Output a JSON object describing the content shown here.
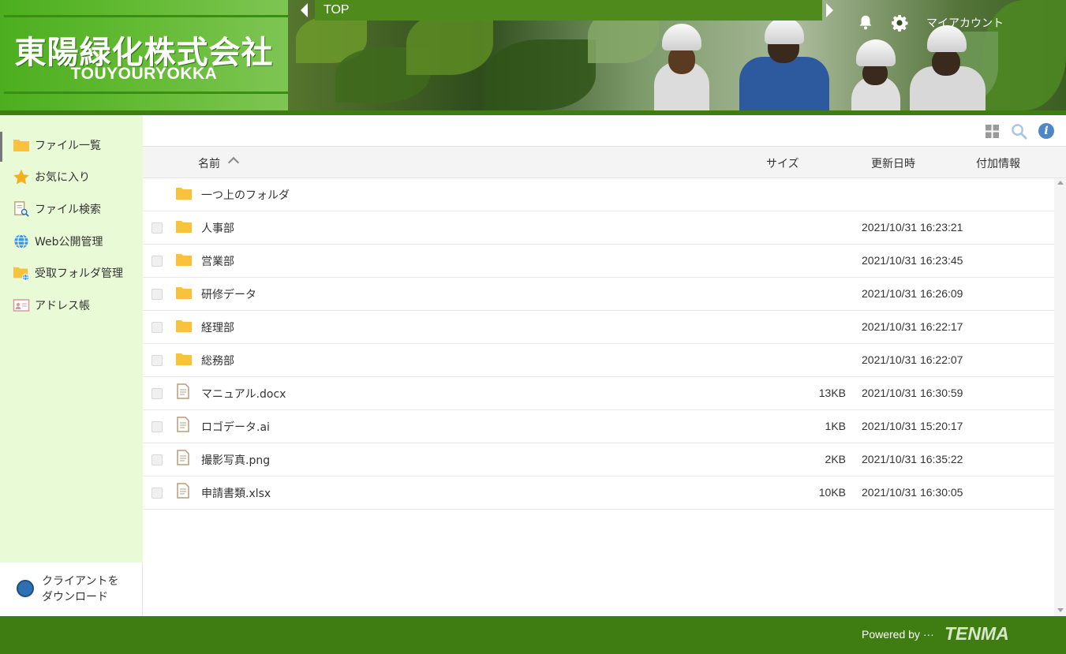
{
  "header": {
    "company_name": "東陽緑化株式会社",
    "company_name_en": "TOUYOURYOKKA",
    "breadcrumb": "TOP",
    "account_label": "マイアカウント"
  },
  "sidebar": {
    "items": [
      {
        "label": "ファイル一覧",
        "icon": "folder-icon"
      },
      {
        "label": "お気に入り",
        "icon": "star-icon"
      },
      {
        "label": "ファイル検索",
        "icon": "file-search-icon"
      },
      {
        "label": "Web公開管理",
        "icon": "globe-icon"
      },
      {
        "label": "受取フォルダ管理",
        "icon": "shared-folder-icon"
      },
      {
        "label": "アドレス帳",
        "icon": "address-book-icon"
      }
    ],
    "download_line1": "クライアントを",
    "download_line2": "ダウンロード"
  },
  "table": {
    "columns": {
      "name": "名前",
      "size": "サイズ",
      "updated": "更新日時",
      "info": "付加情報"
    },
    "parent_folder": "一つ上のフォルダ",
    "rows": [
      {
        "type": "folder",
        "name": "人事部",
        "size": "",
        "updated": "2021/10/31 16:23:21"
      },
      {
        "type": "folder",
        "name": "営業部",
        "size": "",
        "updated": "2021/10/31 16:23:45"
      },
      {
        "type": "folder",
        "name": "研修データ",
        "size": "",
        "updated": "2021/10/31 16:26:09"
      },
      {
        "type": "folder",
        "name": "経理部",
        "size": "",
        "updated": "2021/10/31 16:22:17"
      },
      {
        "type": "folder",
        "name": "総務部",
        "size": "",
        "updated": "2021/10/31 16:22:07"
      },
      {
        "type": "file",
        "name": "マニュアル.docx",
        "size": "13KB",
        "updated": "2021/10/31 16:30:59"
      },
      {
        "type": "file",
        "name": "ロゴデータ.ai",
        "size": "1KB",
        "updated": "2021/10/31 15:20:17"
      },
      {
        "type": "file",
        "name": "撮影写真.png",
        "size": "2KB",
        "updated": "2021/10/31 16:35:22"
      },
      {
        "type": "file",
        "name": "申請書類.xlsx",
        "size": "10KB",
        "updated": "2021/10/31 16:30:05"
      }
    ]
  },
  "toolbar": {
    "info_glyph": "i"
  },
  "footer": {
    "powered_by": "Powered by ···",
    "brand": "TENMA"
  },
  "colors": {
    "brand_green": "#3f7c12",
    "sidebar_bg": "#e9fbd6",
    "folder": "#f9c23c",
    "info_blue": "#4e86c6"
  }
}
